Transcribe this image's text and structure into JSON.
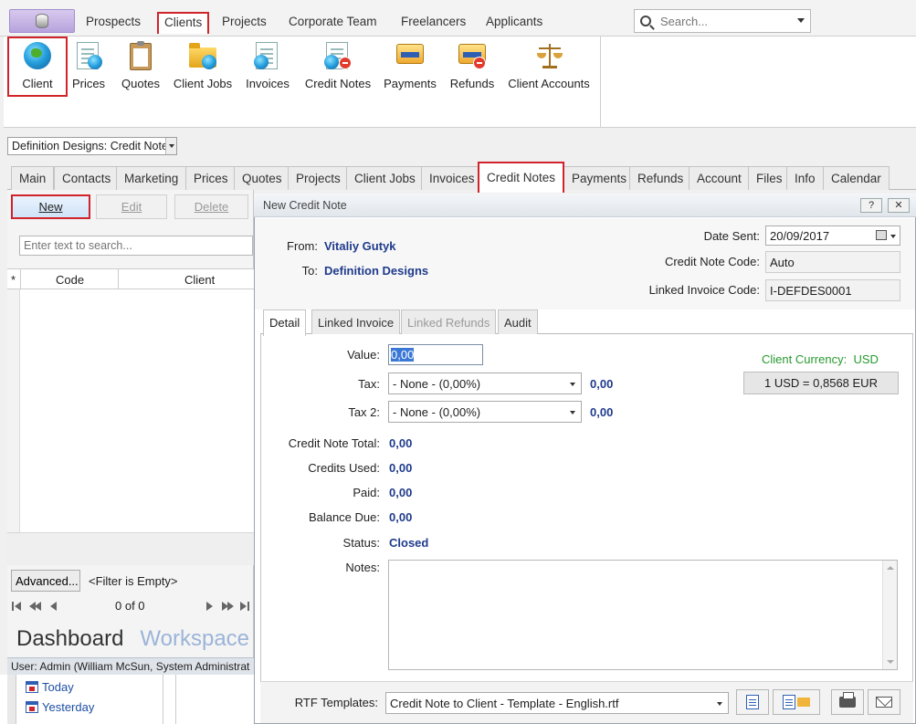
{
  "ribbon_tabs": [
    "Prospects",
    "Clients",
    "Projects",
    "Corporate Team",
    "Freelancers",
    "Applicants"
  ],
  "search": {
    "placeholder": "Search..."
  },
  "ribbon_buttons": [
    "Client",
    "Prices",
    "Quotes",
    "Client Jobs",
    "Invoices",
    "Credit Notes",
    "Payments",
    "Refunds",
    "Client Accounts"
  ],
  "context_selector": "Definition Designs: Credit Notes",
  "client_tabs": [
    "Main",
    "Contacts",
    "Marketing",
    "Prices",
    "Quotes",
    "Projects",
    "Client Jobs",
    "Invoices",
    "Credit Notes",
    "Payments",
    "Refunds",
    "Account",
    "Files",
    "Info",
    "Calendar"
  ],
  "left": {
    "new": "New",
    "edit": "Edit",
    "delete": "Delete",
    "search_placeholder": "Enter text to search...",
    "grid_cols": {
      "marker": "*",
      "code": "Code",
      "client": "Client"
    },
    "advanced": "Advanced...",
    "filter": "<Filter is Empty>",
    "page_count": "0 of 0",
    "dashboard": "Dashboard",
    "workspace": "Workspace",
    "status": "User: Admin (William McSun, System Administrat",
    "tree": [
      "Today",
      "Yesterday"
    ]
  },
  "dialog": {
    "title": "New Credit Note",
    "help": "?",
    "close": "✕",
    "from_label": "From:",
    "from_value": "Vitaliy Gutyk",
    "to_label": "To:",
    "to_value": "Definition Designs",
    "date_label": "Date Sent:",
    "date_value": "20/09/2017",
    "code_label": "Credit Note Code:",
    "code_value": "Auto",
    "linked_label": "Linked Invoice Code:",
    "linked_value": "I-DEFDES0001",
    "tabs": [
      "Detail",
      "Linked Invoice",
      "Linked Refunds",
      "Audit"
    ],
    "value_label": "Value:",
    "value": "0,00",
    "tax_label": "Tax:",
    "tax_value": "- None - (0,00%)",
    "tax_amount": "0,00",
    "tax2_label": "Tax 2:",
    "tax2_value": "- None - (0,00%)",
    "tax2_amount": "0,00",
    "currency_label": "Client Currency:",
    "currency_value": "USD",
    "fx_rate": "1 USD = 0,8568 EUR",
    "total_label": "Credit Note Total:",
    "total": "0,00",
    "credits_label": "Credits Used:",
    "credits": "0,00",
    "paid_label": "Paid:",
    "paid": "0,00",
    "balance_label": "Balance Due:",
    "balance": "0,00",
    "status_label": "Status:",
    "status": "Closed",
    "notes_label": "Notes:",
    "rtf_label": "RTF Templates:",
    "rtf_value": "Credit Note to Client - Template - English.rtf"
  },
  "colors": {
    "highlight": "#d0232a",
    "value_blue": "#1f3b8c",
    "currency_green": "#279a2f"
  }
}
